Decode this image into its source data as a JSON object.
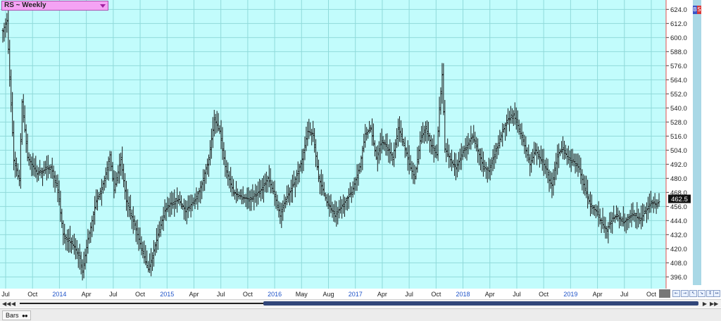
{
  "symbol_label": "RS ~ Weekly",
  "colors": {
    "plot_bg": "#c2fcfc",
    "grid": "#8fdada",
    "bars": "#1a1a1a",
    "price_axis_line": "#e05050",
    "year_label": "#1d52c8",
    "month_label": "#1a1a1a",
    "last_price_box": "#111111"
  },
  "flags": [
    "B",
    "S"
  ],
  "status_tab_label": "Bars",
  "zoom_buttons": [
    "←",
    "→",
    "↖",
    "↘",
    "↕",
    "↔"
  ],
  "chart_data": {
    "type": "bar",
    "subtype": "ohlc",
    "frequency": "weekly",
    "y_ticks": [
      396.0,
      408.0,
      420.0,
      432.0,
      444.0,
      456.0,
      468.0,
      480.0,
      492.0,
      504.0,
      516.0,
      528.0,
      540.0,
      552.0,
      564.0,
      576.0,
      588.0,
      600.0,
      612.0,
      624.0
    ],
    "ylim": [
      386,
      632
    ],
    "last_price": "462.5",
    "x_tick_labels": [
      {
        "label": "Jul",
        "year": false
      },
      {
        "label": "Oct",
        "year": false
      },
      {
        "label": "2014",
        "year": true
      },
      {
        "label": "Apr",
        "year": false
      },
      {
        "label": "Jul",
        "year": false
      },
      {
        "label": "Oct",
        "year": false
      },
      {
        "label": "2015",
        "year": true
      },
      {
        "label": "Apr",
        "year": false
      },
      {
        "label": "Jul",
        "year": false
      },
      {
        "label": "Oct",
        "year": false
      },
      {
        "label": "2016",
        "year": true
      },
      {
        "label": "May",
        "year": false
      },
      {
        "label": "Aug",
        "year": false
      },
      {
        "label": "2017",
        "year": true
      },
      {
        "label": "Apr",
        "year": false
      },
      {
        "label": "Jul",
        "year": false
      },
      {
        "label": "Oct",
        "year": false
      },
      {
        "label": "2018",
        "year": true
      },
      {
        "label": "Apr",
        "year": false
      },
      {
        "label": "Jul",
        "year": false
      },
      {
        "label": "Oct",
        "year": false
      },
      {
        "label": "2019",
        "year": true
      },
      {
        "label": "Apr",
        "year": false
      },
      {
        "label": "Jul",
        "year": false
      },
      {
        "label": "Oct",
        "year": false
      }
    ],
    "anchors": [
      [
        0,
        606
      ],
      [
        3,
        614
      ],
      [
        8,
        495
      ],
      [
        12,
        478
      ],
      [
        14,
        545
      ],
      [
        18,
        498
      ],
      [
        25,
        484
      ],
      [
        35,
        490
      ],
      [
        40,
        470
      ],
      [
        44,
        432
      ],
      [
        52,
        422
      ],
      [
        56,
        412
      ],
      [
        58,
        400
      ],
      [
        62,
        428
      ],
      [
        68,
        460
      ],
      [
        74,
        478
      ],
      [
        78,
        500
      ],
      [
        81,
        470
      ],
      [
        86,
        496
      ],
      [
        90,
        460
      ],
      [
        96,
        440
      ],
      [
        102,
        416
      ],
      [
        106,
        402
      ],
      [
        110,
        418
      ],
      [
        114,
        436
      ],
      [
        118,
        452
      ],
      [
        122,
        458
      ],
      [
        128,
        462
      ],
      [
        133,
        452
      ],
      [
        140,
        462
      ],
      [
        144,
        472
      ],
      [
        150,
        496
      ],
      [
        154,
        530
      ],
      [
        158,
        520
      ],
      [
        162,
        490
      ],
      [
        168,
        468
      ],
      [
        174,
        464
      ],
      [
        180,
        462
      ],
      [
        184,
        466
      ],
      [
        188,
        470
      ],
      [
        193,
        480
      ],
      [
        198,
        466
      ],
      [
        202,
        448
      ],
      [
        206,
        462
      ],
      [
        212,
        476
      ],
      [
        218,
        496
      ],
      [
        222,
        520
      ],
      [
        226,
        518
      ],
      [
        230,
        480
      ],
      [
        236,
        460
      ],
      [
        242,
        448
      ],
      [
        248,
        458
      ],
      [
        254,
        468
      ],
      [
        260,
        490
      ],
      [
        264,
        518
      ],
      [
        268,
        522
      ],
      [
        272,
        498
      ],
      [
        276,
        512
      ],
      [
        280,
        506
      ],
      [
        284,
        498
      ],
      [
        288,
        522
      ],
      [
        292,
        510
      ],
      [
        296,
        492
      ],
      [
        300,
        480
      ],
      [
        304,
        512
      ],
      [
        308,
        524
      ],
      [
        312,
        508
      ],
      [
        316,
        500
      ],
      [
        318,
        540
      ],
      [
        320,
        568
      ],
      [
        322,
        505
      ],
      [
        326,
        496
      ],
      [
        330,
        488
      ],
      [
        334,
        500
      ],
      [
        338,
        508
      ],
      [
        342,
        516
      ],
      [
        346,
        504
      ],
      [
        350,
        490
      ],
      [
        354,
        486
      ],
      [
        358,
        500
      ],
      [
        364,
        520
      ],
      [
        368,
        530
      ],
      [
        372,
        534
      ],
      [
        376,
        522
      ],
      [
        380,
        508
      ],
      [
        384,
        492
      ],
      [
        388,
        504
      ],
      [
        392,
        496
      ],
      [
        396,
        488
      ],
      [
        398,
        478
      ],
      [
        400,
        474
      ],
      [
        404,
        500
      ],
      [
        408,
        506
      ],
      [
        412,
        496
      ],
      [
        416,
        494
      ],
      [
        420,
        488
      ],
      [
        424,
        470
      ],
      [
        428,
        458
      ],
      [
        432,
        452
      ],
      [
        436,
        442
      ],
      [
        440,
        436
      ],
      [
        444,
        446
      ],
      [
        448,
        448
      ],
      [
        452,
        442
      ],
      [
        456,
        446
      ],
      [
        460,
        450
      ],
      [
        464,
        444
      ],
      [
        468,
        452
      ],
      [
        472,
        460
      ],
      [
        476,
        458
      ],
      [
        478,
        460
      ]
    ]
  }
}
